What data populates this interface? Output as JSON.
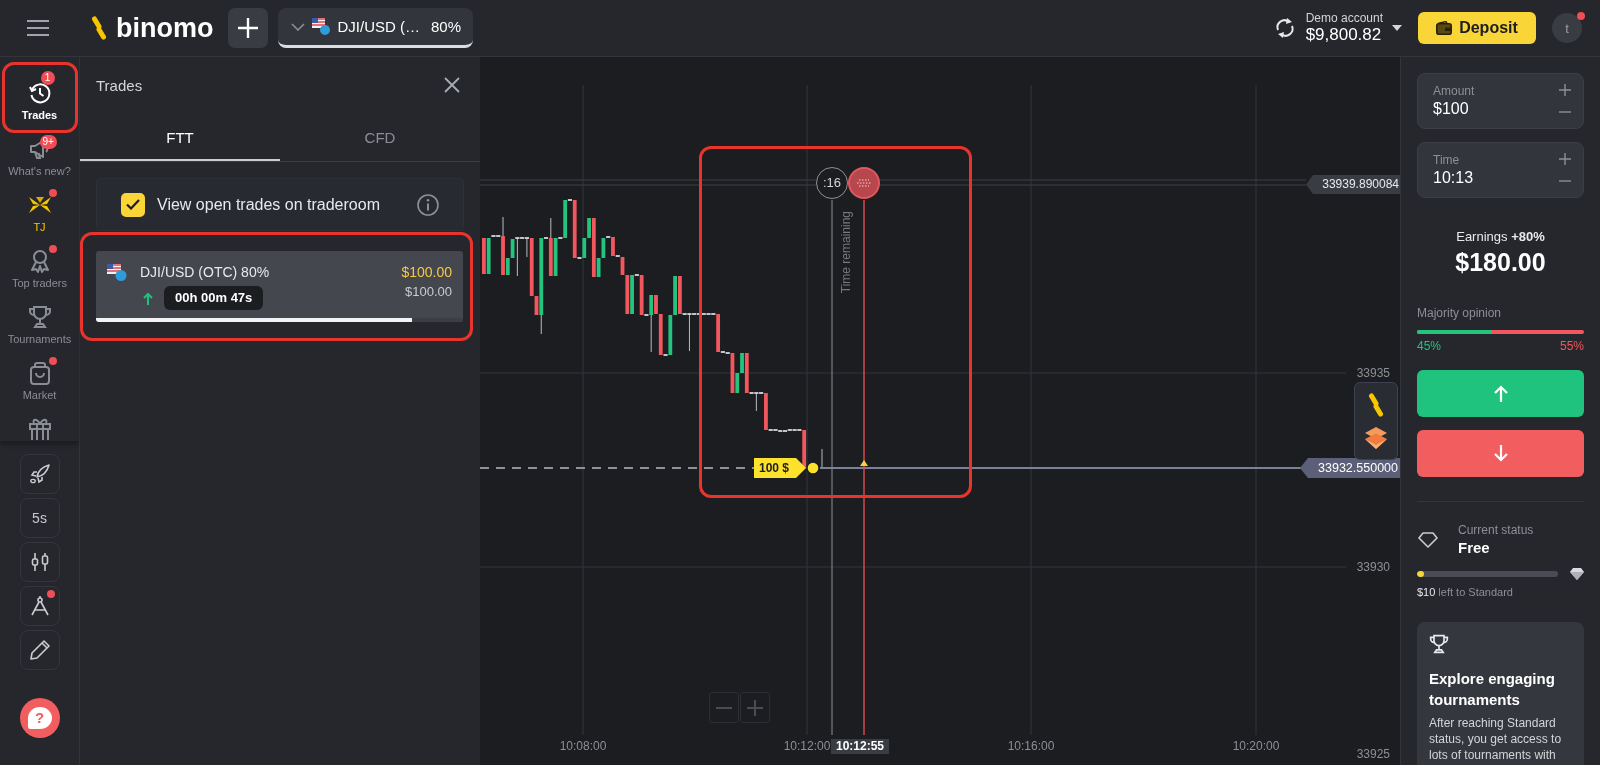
{
  "top_bar": {
    "logo": "binomo",
    "asset": {
      "name": "DJI/USD (…",
      "payout": "80%"
    },
    "account": {
      "label": "Demo account",
      "balance": "$9,800.82"
    },
    "deposit": "Deposit",
    "avatar": {
      "initial": "t",
      "dot": true
    }
  },
  "sidebar": {
    "items": [
      {
        "kind": "trades",
        "label": "Trades",
        "badge": "1",
        "dot": false,
        "selected": true,
        "annotated": true
      },
      {
        "kind": "news",
        "label": "What's new?",
        "badge": "9+",
        "dot": false,
        "selected": false,
        "annotated": false
      },
      {
        "kind": "tj",
        "label": "TJ",
        "dot": true,
        "selected": false,
        "annotated": false
      },
      {
        "kind": "top_traders",
        "label": "Top traders",
        "dot": true,
        "selected": false,
        "annotated": false
      },
      {
        "kind": "tournaments",
        "label": "Tournaments",
        "dot": false,
        "selected": false,
        "annotated": false
      },
      {
        "kind": "market",
        "label": "Market",
        "dot": true,
        "selected": false,
        "annotated": false
      },
      {
        "kind": "gift",
        "dot": false,
        "selected": false,
        "annotated": false
      }
    ],
    "tools": [
      {
        "kind": "rocket",
        "dot": false
      },
      {
        "kind": "interval",
        "label": "5s",
        "dot": false
      },
      {
        "kind": "candles",
        "dot": false
      },
      {
        "kind": "compass",
        "dot": true
      },
      {
        "kind": "pencil",
        "dot": false
      }
    ],
    "help": {
      "label": "?"
    }
  },
  "trades_panel": {
    "title": "Trades",
    "tabs": [
      {
        "label": "FTT",
        "selected": true
      },
      {
        "label": "CFD",
        "selected": false
      }
    ],
    "open_trades_toggle": {
      "label": "View open trades on traderoom",
      "checked": true
    },
    "trades": [
      {
        "kind": "up",
        "asset": "DJI/USD (OTC) 80%",
        "amount": "$100.00",
        "payout": "$100.00",
        "time_left": "00h 00m 47s",
        "level": 0.86,
        "annotated": true
      }
    ]
  },
  "chart": {
    "annotated": true,
    "timer": ":16",
    "timer_label": "Time remaining",
    "trade_tag": "100 $",
    "price_tags": [
      {
        "kind": "level",
        "value": "33939.890084"
      },
      {
        "kind": "current",
        "value": "33932.550000"
      }
    ],
    "price_axis": [
      "33935",
      "33930",
      "33925"
    ],
    "time_axis": [
      {
        "label": "10:08:00",
        "selected": false
      },
      {
        "label": "10:12:00",
        "selected": false
      },
      {
        "label": "10:12:55",
        "selected": true
      },
      {
        "label": "10:16:00",
        "selected": false
      },
      {
        "label": "10:20:00",
        "selected": false
      }
    ]
  },
  "right_panel": {
    "amount": {
      "label": "Amount",
      "value": "$100"
    },
    "time": {
      "label": "Time",
      "value": "10:13"
    },
    "earnings": {
      "label": "Earnings **+80%**",
      "value": "$180.00"
    },
    "majority_opinion": {
      "label": "Majority opinion",
      "level": 0.45,
      "up": "45%",
      "down": "55%"
    },
    "trade_buttons": [
      {
        "kind": "up"
      },
      {
        "kind": "down"
      }
    ],
    "status": {
      "label": "Current status",
      "value": "Free",
      "level": 0.05,
      "amount": "$10",
      "note": "left to Standard"
    },
    "promo": {
      "title": "Explore engaging tournaments",
      "text": "After reaching Standard status, you get access to lots of tournaments with"
    }
  }
}
